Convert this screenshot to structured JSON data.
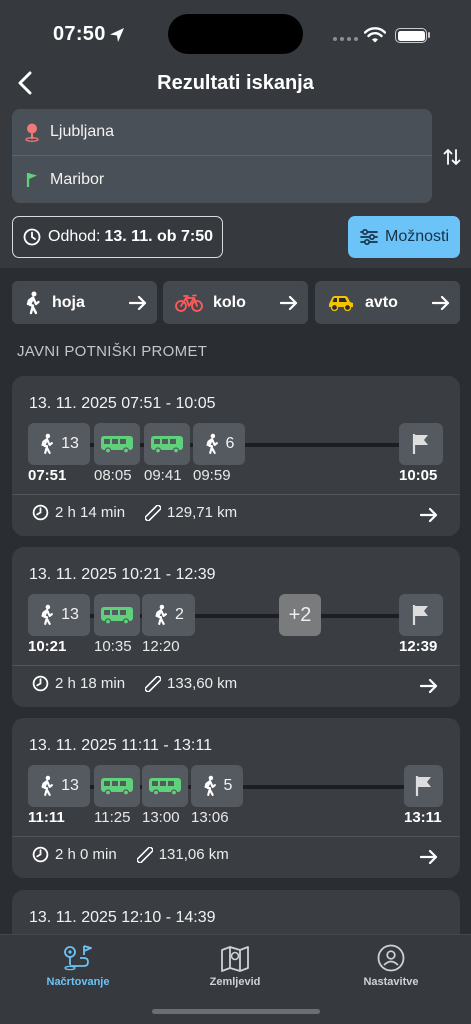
{
  "status": {
    "time": "07:50"
  },
  "header": {
    "title": "Rezultati iskanja"
  },
  "route": {
    "from": "Ljubljana",
    "to": "Maribor"
  },
  "departure": {
    "label": "Odhod:",
    "value": "13. 11. ob 7:50"
  },
  "options": {
    "label": "Možnosti"
  },
  "modes": [
    {
      "label": "hoja",
      "icon": "walk-icon"
    },
    {
      "label": "kolo",
      "icon": "bike-icon"
    },
    {
      "label": "avto",
      "icon": "car-icon"
    }
  ],
  "section_title": "JAVNI POTNIŠKI PROMET",
  "colors": {
    "accent": "#6cc3f7",
    "bus": "#5ed17a",
    "bike": "#ff5a5a",
    "car": "#f5c400"
  },
  "results": [
    {
      "time_range": "13. 11. 2025 07:51 - 10:05",
      "segments": [
        {
          "type": "walk",
          "count": "13",
          "time": "07:51"
        },
        {
          "type": "bus",
          "time": "08:05"
        },
        {
          "type": "bus",
          "time": "09:41"
        },
        {
          "type": "walk",
          "count": "6",
          "time": "09:59"
        }
      ],
      "arrival": "10:05",
      "duration": "2 h 14 min",
      "distance": "129,71 km"
    },
    {
      "time_range": "13. 11. 2025 10:21 - 12:39",
      "segments": [
        {
          "type": "walk",
          "count": "13",
          "time": "10:21"
        },
        {
          "type": "bus",
          "time": "10:35"
        },
        {
          "type": "walk",
          "count": "2",
          "time": "12:20"
        }
      ],
      "more": "+2",
      "arrival": "12:39",
      "duration": "2 h 18 min",
      "distance": "133,60 km"
    },
    {
      "time_range": "13. 11. 2025 11:11 - 13:11",
      "segments": [
        {
          "type": "walk",
          "count": "13",
          "time": "11:11"
        },
        {
          "type": "bus",
          "time": "11:25"
        },
        {
          "type": "bus",
          "time": "13:00"
        },
        {
          "type": "walk",
          "count": "5",
          "time": "13:06"
        }
      ],
      "arrival": "13:11",
      "duration": "2 h 0 min",
      "distance": "131,06 km"
    },
    {
      "time_range": "13. 11. 2025 12:10 - 14:39"
    }
  ],
  "nav": [
    {
      "label": "Načrtovanje",
      "icon": "route-plan-icon"
    },
    {
      "label": "Zemljevid",
      "icon": "map-icon"
    },
    {
      "label": "Nastavitve",
      "icon": "settings-user-icon"
    }
  ]
}
